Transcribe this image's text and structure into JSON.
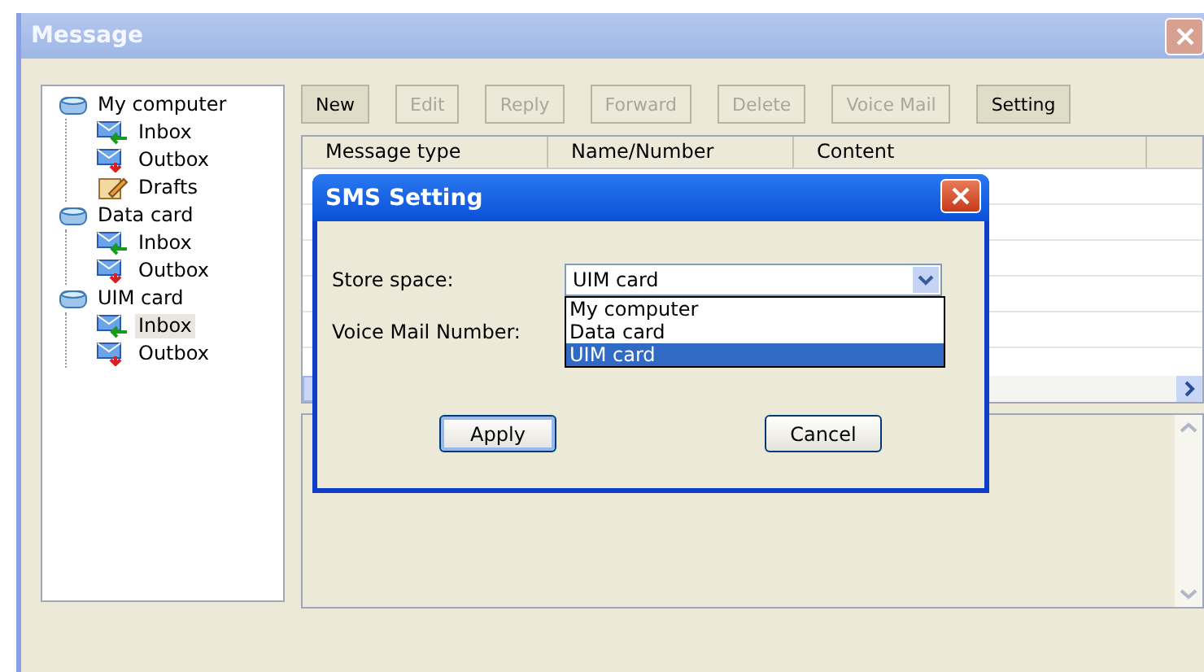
{
  "window": {
    "title": "Message"
  },
  "tree": [
    {
      "label": "My computer",
      "kind": "folder",
      "selected": false,
      "children": [
        {
          "label": "Inbox",
          "kind": "inbox",
          "selected": false
        },
        {
          "label": "Outbox",
          "kind": "outbox",
          "selected": false
        },
        {
          "label": "Drafts",
          "kind": "drafts",
          "selected": false
        }
      ]
    },
    {
      "label": "Data card",
      "kind": "folder",
      "selected": false,
      "children": [
        {
          "label": "Inbox",
          "kind": "inbox",
          "selected": false
        },
        {
          "label": "Outbox",
          "kind": "outbox",
          "selected": false
        }
      ]
    },
    {
      "label": "UIM card",
      "kind": "folder",
      "selected": false,
      "children": [
        {
          "label": "Inbox",
          "kind": "inbox",
          "selected": true
        },
        {
          "label": "Outbox",
          "kind": "outbox",
          "selected": false
        }
      ]
    }
  ],
  "toolbar": [
    {
      "label": "New",
      "disabled": false
    },
    {
      "label": "Edit",
      "disabled": true
    },
    {
      "label": "Reply",
      "disabled": true
    },
    {
      "label": "Forward",
      "disabled": true
    },
    {
      "label": "Delete",
      "disabled": true
    },
    {
      "label": "Voice Mail",
      "disabled": true
    },
    {
      "label": "Setting",
      "disabled": false
    }
  ],
  "table": {
    "columns": [
      "Message type",
      "Name/Number",
      "Content"
    ]
  },
  "dialog": {
    "title": "SMS Setting",
    "fields": [
      {
        "label": "Store space:",
        "kind": "combo",
        "value": "UIM card",
        "expanded": true,
        "options": [
          {
            "label": "My computer",
            "selected": false
          },
          {
            "label": "Data card",
            "selected": false
          },
          {
            "label": "UIM card",
            "selected": true
          }
        ]
      },
      {
        "label": "Voice Mail Number:",
        "kind": "label"
      }
    ],
    "buttons": [
      {
        "label": "Apply",
        "default": true
      },
      {
        "label": "Cancel",
        "default": false
      }
    ]
  }
}
